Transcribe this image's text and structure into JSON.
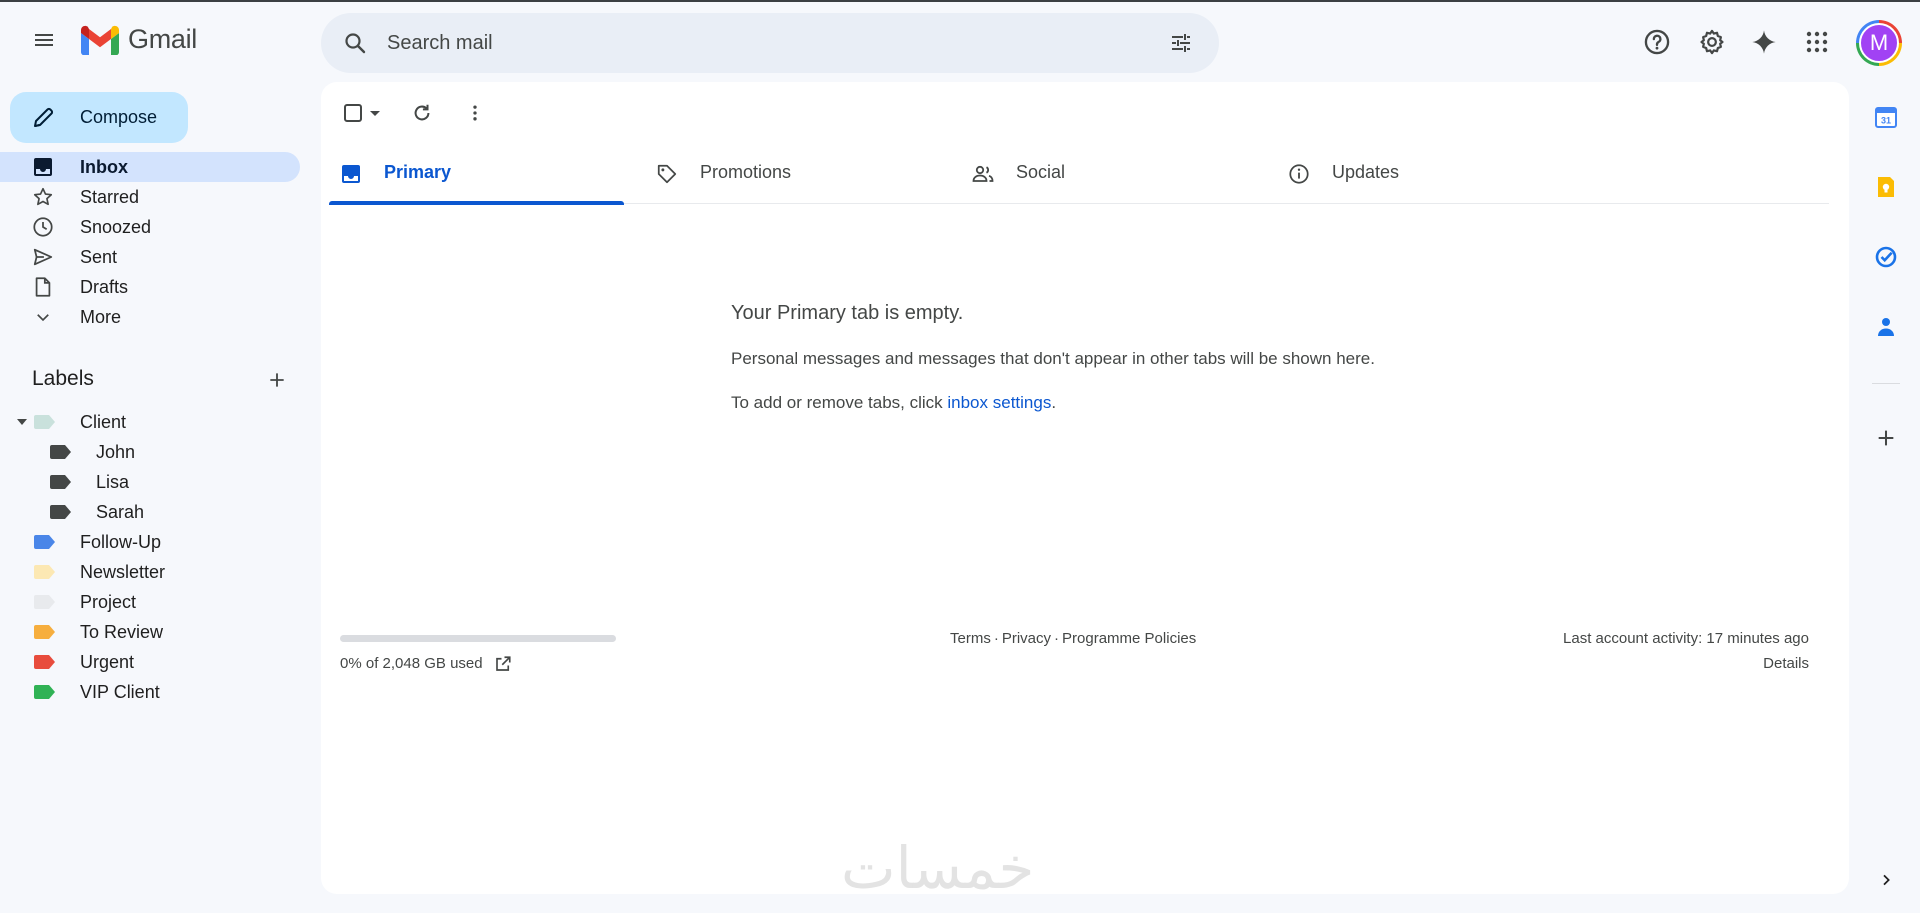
{
  "app": {
    "brand": "Gmail"
  },
  "search": {
    "placeholder": "Search mail"
  },
  "compose": {
    "label": "Compose"
  },
  "nav": {
    "items": [
      {
        "label": "Inbox",
        "icon": "inbox-icon",
        "active": true
      },
      {
        "label": "Starred",
        "icon": "star-icon"
      },
      {
        "label": "Snoozed",
        "icon": "clock-icon"
      },
      {
        "label": "Sent",
        "icon": "send-icon"
      },
      {
        "label": "Drafts",
        "icon": "draft-icon"
      },
      {
        "label": "More",
        "icon": "chevron-down-icon"
      }
    ]
  },
  "labels": {
    "heading": "Labels",
    "items": [
      {
        "label": "Client",
        "color": "#c9e1dc",
        "indent": 0,
        "expanded": true
      },
      {
        "label": "John",
        "color": "#444746",
        "indent": 1
      },
      {
        "label": "Lisa",
        "color": "#444746",
        "indent": 1
      },
      {
        "label": "Sarah",
        "color": "#444746",
        "indent": 1
      },
      {
        "label": "Follow-Up",
        "color": "#4a86e8",
        "indent": 0
      },
      {
        "label": "Newsletter",
        "color": "#fce8b3",
        "indent": 0
      },
      {
        "label": "Project",
        "color": "#e8eaed",
        "indent": 0
      },
      {
        "label": "To Review",
        "color": "#f6ae3e",
        "indent": 0
      },
      {
        "label": "Urgent",
        "color": "#e84c3d",
        "indent": 0
      },
      {
        "label": "VIP Client",
        "color": "#30b255",
        "indent": 0
      }
    ]
  },
  "tabs": [
    {
      "label": "Primary",
      "icon": "inbox-icon",
      "active": true
    },
    {
      "label": "Promotions",
      "icon": "tag-icon"
    },
    {
      "label": "Social",
      "icon": "people-icon"
    },
    {
      "label": "Updates",
      "icon": "info-icon"
    }
  ],
  "empty": {
    "title": "Your Primary tab is empty.",
    "description": "Personal messages and messages that don't appear in other tabs will be shown here.",
    "hint_prefix": "To add or remove tabs, click ",
    "hint_link": "inbox settings",
    "hint_suffix": "."
  },
  "storage": {
    "text": "0% of 2,048 GB used",
    "fraction_used": 0.0
  },
  "footer": {
    "terms": "Terms",
    "privacy": "Privacy",
    "policies": "Programme Policies",
    "sep": "·",
    "activity": "Last account activity: 17 minutes ago",
    "details": "Details"
  },
  "account": {
    "initial": "M"
  },
  "watermark": "خمسات",
  "colors": {
    "accent": "#0b57d0",
    "compose_bg": "#c2e7ff",
    "active_nav_bg": "#d3e3fd",
    "page_bg": "#f6f8fc"
  }
}
